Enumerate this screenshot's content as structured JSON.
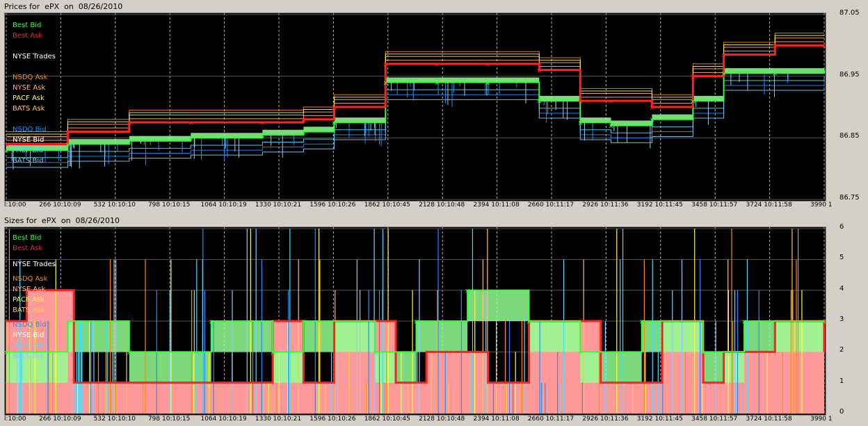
{
  "chart_data": [
    {
      "type": "line",
      "title": "Prices for  ePX  on  08/26/2010",
      "ylim": [
        86.75,
        87.05
      ],
      "y_ticks": [
        "87.05",
        "86.95",
        "86.85",
        "86.75"
      ],
      "x_ticks": [
        "l:10:00",
        "266 10:10:09",
        "532 10:10:10",
        "798 10:10:15",
        "1064 10:10:19",
        "1330 10:10:21",
        "1596 10:10:26",
        "1862 10:10:45",
        "2128 10:10:48",
        "2394 10:11:08",
        "2660 10:11:17",
        "2926 10:11:36",
        "3192 10:11:45",
        "3458 10:11:57",
        "3724 10:11:58",
        "3990 1"
      ],
      "legend": [
        "Best Bid",
        "Best Ask",
        "NYSE Trades",
        "NSDQ Ask",
        "NYSE Ask",
        "PACF Ask",
        "BATS Ask",
        "NSDQ Bid",
        "NYSE Bid",
        "PACF Bid",
        "BATS Bid"
      ],
      "xlim": [
        0,
        3990
      ],
      "series": [
        {
          "name": "Best Bid",
          "x": [
            0,
            300,
            600,
            900,
            1250,
            1450,
            1600,
            1850,
            2100,
            2350,
            2600,
            2800,
            2950,
            3150,
            3350,
            3500,
            3750,
            3990
          ],
          "values": [
            86.83,
            86.84,
            86.845,
            86.85,
            86.855,
            86.86,
            86.875,
            86.94,
            86.94,
            86.94,
            86.91,
            86.875,
            86.87,
            86.88,
            86.91,
            86.955,
            86.955,
            86.96
          ]
        },
        {
          "name": "Best Ask",
          "x": [
            0,
            300,
            600,
            900,
            1250,
            1450,
            1600,
            1850,
            2100,
            2350,
            2600,
            2800,
            2950,
            3150,
            3350,
            3500,
            3750,
            3990
          ],
          "values": [
            86.84,
            86.86,
            86.875,
            86.875,
            86.875,
            86.88,
            86.9,
            86.97,
            86.97,
            86.97,
            86.96,
            86.91,
            86.91,
            86.9,
            86.95,
            86.985,
            87.0,
            87.0
          ]
        }
      ]
    },
    {
      "type": "bar",
      "title": "Sizes for  ePX  on  08/26/2010",
      "ylim": [
        0,
        6
      ],
      "y_ticks": [
        "6",
        "5",
        "4",
        "3",
        "2",
        "1",
        "0"
      ],
      "x_ticks": [
        "l:10:00",
        "266 10:10:09",
        "532 10:10:10",
        "798 10:10:15",
        "1064 10:10:19",
        "1330 10:10:21",
        "1596 10:10:26",
        "1862 10:10:45",
        "2128 10:10:48",
        "2394 10:11:08",
        "2660 10:11:17",
        "2926 10:11:36",
        "3192 10:11:45",
        "3458 10:11:57",
        "3724 10:11:58",
        "3990 1"
      ],
      "legend": [
        "Best Bid",
        "Best Ask",
        "NYSE Trades",
        "NSDQ Ask",
        "NYSE Ask",
        "PACF Ask",
        "BATS Ask",
        "NSDQ Bid",
        "NYSE Bid",
        "PACF Bid",
        "BATS Bid"
      ],
      "xlim": [
        0,
        3990
      ],
      "series": [
        {
          "name": "Best Ask",
          "x": [
            0,
            100,
            330,
            1300,
            1450,
            1600,
            1900,
            2050,
            2350,
            2550,
            2900,
            3200,
            3400,
            3500,
            3750,
            3990
          ],
          "values": [
            3,
            4,
            1,
            3,
            1,
            3,
            1,
            2,
            1,
            3,
            1,
            3,
            1,
            2,
            3,
            2
          ]
        },
        {
          "name": "Best Bid",
          "x": [
            0,
            300,
            600,
            1000,
            1300,
            1450,
            1800,
            2000,
            2250,
            2550,
            2800,
            3100,
            3400,
            3600,
            3990
          ],
          "values": [
            2,
            3,
            2,
            3,
            2,
            3,
            2,
            3,
            4,
            3,
            2,
            3,
            2,
            3,
            3
          ]
        }
      ]
    }
  ],
  "legend_colors": {
    "Best Bid": "#33ff33",
    "Best Ask": "#ff2222",
    "NYSE Trades": "#ffffff",
    "NSDQ Ask": "#ff8c00",
    "NYSE Ask": "#ffb080",
    "PACF Ask": "#ffff33",
    "BATS Ask": "#ffc060",
    "NSDQ Bid": "#1e90ff",
    "NYSE Bid": "#ffffff",
    "PACF Bid": "#40e0ff",
    "BATS Bid": "#87cefa"
  },
  "fill_colors": {
    "bid_fill": "#90ff90",
    "ask_fill": "#ff9999"
  }
}
